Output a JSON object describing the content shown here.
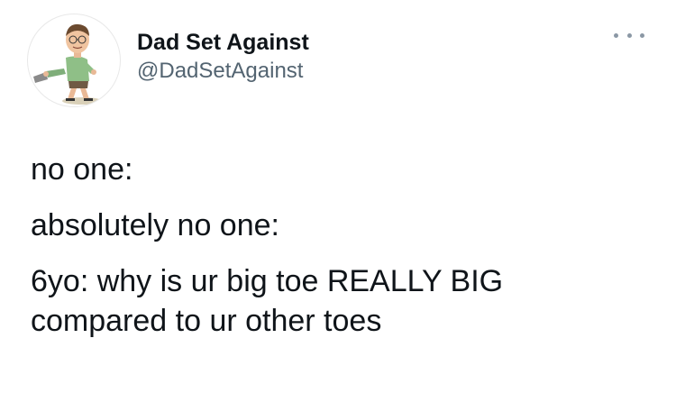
{
  "author": {
    "display_name": "Dad Set Against",
    "handle": "@DadSetAgainst",
    "avatar_icon": "cartoon-dad-bitmoji-avatar"
  },
  "menu": {
    "icon": "more-horizontal-icon"
  },
  "tweet": {
    "lines": [
      "no one:",
      "absolutely no one:",
      "6yo: why is ur big toe REALLY BIG",
      "compared to ur other toes"
    ]
  },
  "colors": {
    "text": "#0f1419",
    "secondary": "#536471",
    "background": "#ffffff"
  }
}
